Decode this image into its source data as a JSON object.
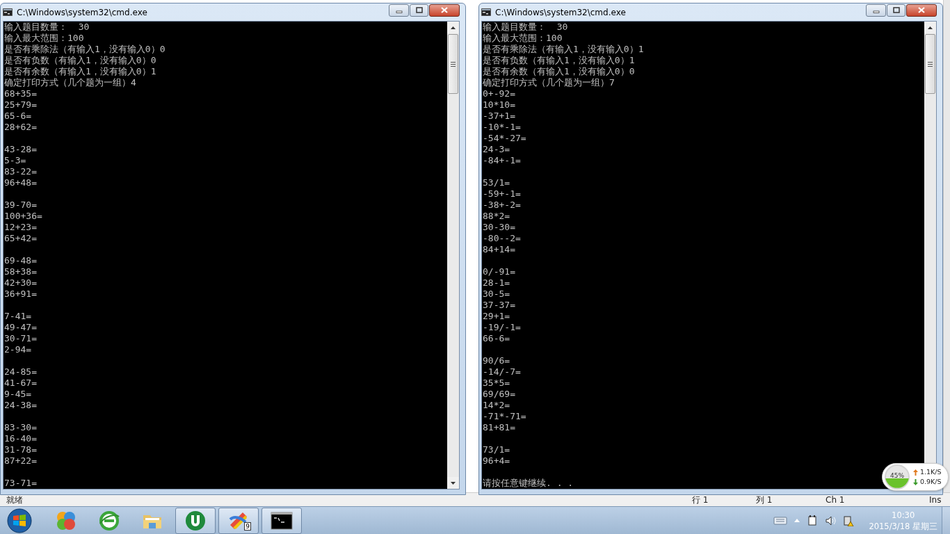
{
  "editor_status_bar": {
    "status": "就绪",
    "line": "行 1",
    "column": "列 1",
    "char": "Ch 1",
    "mode": "Ins"
  },
  "windows": [
    {
      "title": "C:\\Windows\\system32\\cmd.exe",
      "header_lines": [
        "输入题目数量：  30",
        "输入最大范围：100",
        "是否有乘除法（有输入1，没有输入0）0",
        "是否有负数（有输入1，没有输入0）0",
        "是否有余数（有输入1，没有输入0）1",
        "确定打印方式（几个题为一组）4"
      ],
      "groups": [
        {
          "problems": [
            "68+35=",
            "25+79=",
            "65-6=",
            "28+62="
          ]
        },
        {
          "problems": [
            "43-28=",
            "5-3=",
            "83-22=",
            "96+48="
          ]
        },
        {
          "problems": [
            "39-70=",
            "100+36=",
            "12+23=",
            "65+42="
          ]
        },
        {
          "problems": [
            "69-48=",
            "58+38=",
            "42+30=",
            "36+91="
          ]
        },
        {
          "problems": [
            "7-41=",
            "49-47=",
            "30-71=",
            "2-94="
          ]
        },
        {
          "problems": [
            "24-85=",
            "41-67=",
            "9-45=",
            "24-38="
          ]
        },
        {
          "problems": [
            "83-30=",
            "16-40=",
            "31-78=",
            "87+22="
          ]
        },
        {
          "problems": [
            "73-71="
          ]
        }
      ]
    },
    {
      "title": "C:\\Windows\\system32\\cmd.exe",
      "header_lines": [
        "输入题目数量：  30",
        "输入最大范围：100",
        "是否有乘除法（有输入1，没有输入0）1",
        "是否有负数（有输入1，没有输入0）1",
        "是否有余数（有输入1，没有输入0）0",
        "确定打印方式（几个题为一组）7"
      ],
      "groups": [
        {
          "problems": [
            "0+-92=",
            "10*10=",
            "-37+1=",
            "-10*-1=",
            "-54*-27=",
            "24-3=",
            "-84+-1="
          ]
        },
        {
          "problems": [
            "53/1=",
            "-59+-1=",
            "-38+-2=",
            "88*2=",
            "30-30=",
            "-80--2=",
            "84+14="
          ]
        },
        {
          "problems": [
            "0/-91=",
            "28-1=",
            "30-5=",
            "37-37=",
            "29+1=",
            "-19/-1=",
            "66-6="
          ]
        },
        {
          "problems": [
            "90/6=",
            "-14/-7=",
            "35*5=",
            "69/69=",
            "14*2=",
            "-71*-71=",
            "81+81="
          ]
        },
        {
          "problems": [
            "73/1=",
            "96+4="
          ]
        }
      ],
      "prompt": "请按任意键继续. . ."
    }
  ],
  "network_widget": {
    "usage": "45%",
    "upload": "1.1K/S",
    "download": "0.9K/S"
  },
  "taskbar": {
    "items": [
      {
        "kind": "colorball",
        "selected": false
      },
      {
        "kind": "browser",
        "selected": false
      },
      {
        "kind": "folder",
        "selected": false
      },
      {
        "kind": "torrent",
        "selected": true
      },
      {
        "kind": "tool",
        "selected": true,
        "badge": "9"
      },
      {
        "kind": "console",
        "selected": true
      }
    ],
    "clock": {
      "time": "10:30",
      "date": "2015/3/18 星期三"
    }
  }
}
